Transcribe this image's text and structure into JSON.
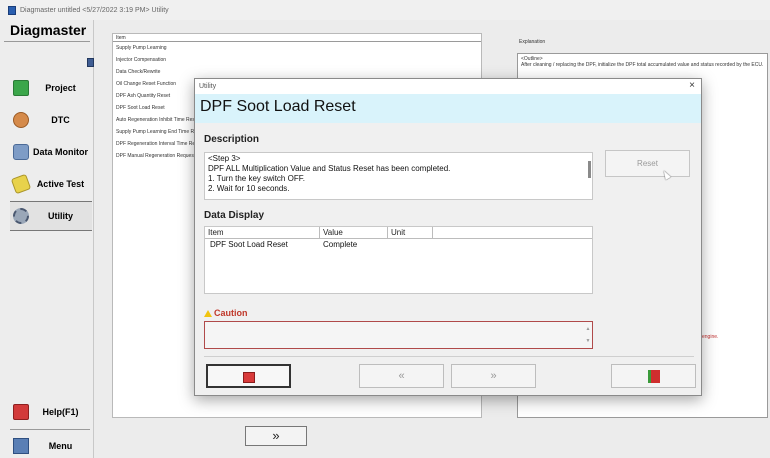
{
  "window": {
    "title": "Diagmaster untitled <5/27/2022 3:19 PM> Utility"
  },
  "sidebar": {
    "brand": "Diagmaster",
    "items": [
      {
        "label": "Project",
        "icon": "project-icon"
      },
      {
        "label": "DTC",
        "icon": "dtc-icon"
      },
      {
        "label": "Data Monitor",
        "icon": "data-monitor-icon"
      },
      {
        "label": "Active Test",
        "icon": "active-test-icon"
      },
      {
        "label": "Utility",
        "icon": "utility-icon"
      }
    ],
    "help": "Help(F1)",
    "menu": "Menu"
  },
  "utility_list": {
    "header": "Item",
    "items": [
      "Supply Pump Learning",
      "Injector Compensation",
      "Data Check/Rewrite",
      "Oil Change Reset Function",
      "DPF Ash Quantity Reset",
      "DPF Soot Load Reset",
      "Auto Regeneration Inhibit Time Reset",
      "Supply Pump Learning End Time Reset",
      "DPF Regeneration Interval Time Reset",
      "DPF Manual Regeneration Request Reset"
    ]
  },
  "explanation": {
    "label": "Explanation",
    "outline_heading": "<Outline>",
    "text": "After cleaning / replacing the DPF, initialize the DPF total accumulated value and status recorded by the ECU.",
    "red_fragment": "engine."
  },
  "next_button": "»",
  "dialog": {
    "window_title": "Utility",
    "close": "×",
    "header_title": "DPF Soot Load Reset",
    "description": {
      "label": "Description",
      "lines": [
        "<Step 3>",
        "DPF ALL Multiplication Value and Status Reset has been completed.",
        "1. Turn the key switch OFF.",
        "2. Wait for 10 seconds."
      ]
    },
    "reset_button": "Reset",
    "data_display": {
      "label": "Data Display",
      "columns": [
        "Item",
        "Value",
        "Unit"
      ],
      "rows": [
        {
          "item": "DPF Soot Load Reset",
          "value": "Complete",
          "unit": ""
        }
      ]
    },
    "caution": {
      "label": "Caution",
      "text": ""
    },
    "footer": {
      "manual_icon": "book-icon",
      "back": "«",
      "forward": "»",
      "exit_icon": "exit-door-icon"
    }
  },
  "colors": {
    "dialog_header_bg": "#d9f3fb",
    "caution_text": "#c0392b"
  }
}
